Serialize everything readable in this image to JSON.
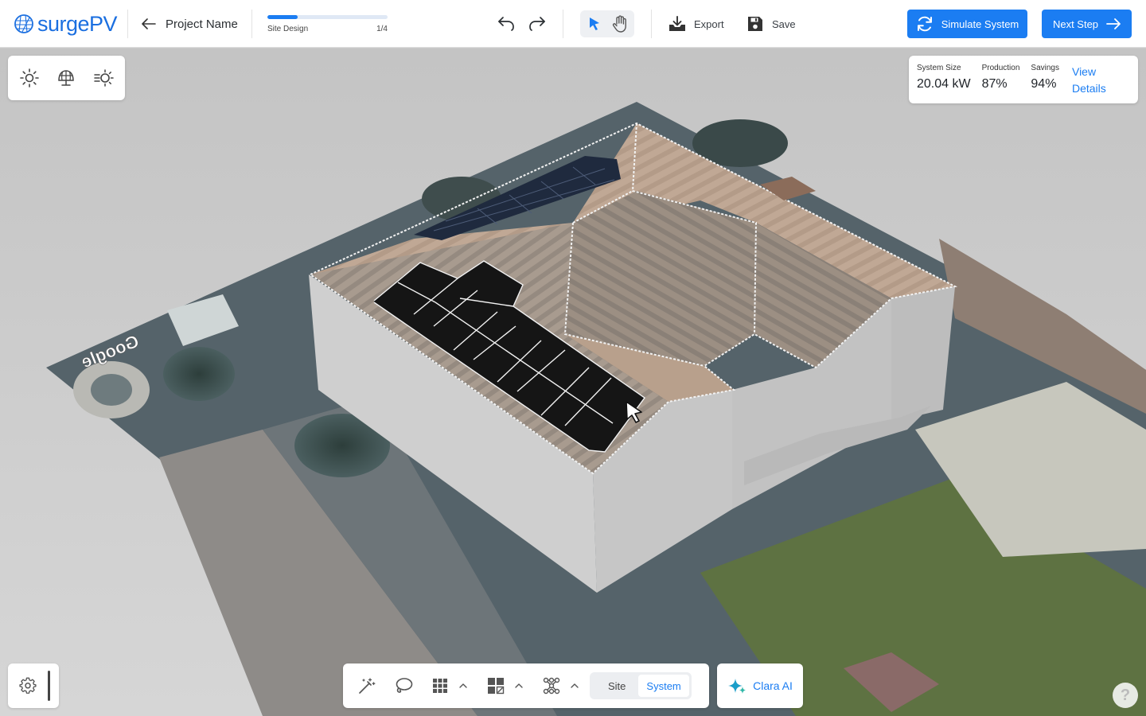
{
  "app": {
    "logo_text": "surgePV",
    "project_name": "Project Name"
  },
  "progress": {
    "step_label": "Site Design",
    "step_count": "1/4",
    "fraction": 0.25
  },
  "toolbar": {
    "export_label": "Export",
    "save_label": "Save",
    "simulate_label": "Simulate System",
    "next_label": "Next Step"
  },
  "stats": {
    "system_size_label": "System Size",
    "system_size_value": "20.04 kW",
    "production_label": "Production",
    "production_value": "87%",
    "savings_label": "Savings",
    "savings_value": "94%",
    "view_label": "View",
    "details_label": "Details"
  },
  "bottom": {
    "site_label": "Site",
    "system_label": "System",
    "active_segment": "System",
    "clara_label": "Clara AI"
  },
  "map": {
    "watermark": "Google"
  },
  "colors": {
    "accent": "#1b7df2",
    "logo": "#1b6fe0"
  }
}
